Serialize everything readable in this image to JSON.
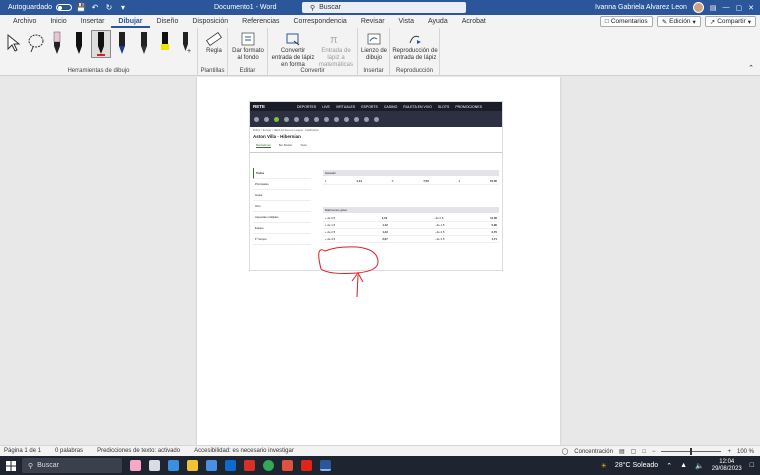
{
  "titlebar": {
    "autosave_label": "Autoguardado",
    "doc_title": "Documento1 - Word",
    "search_placeholder": "Buscar",
    "user_name": "Ivanna Gabriela Alvarez Leon"
  },
  "tabs": [
    "Archivo",
    "Inicio",
    "Insertar",
    "Dibujar",
    "Diseño",
    "Disposición",
    "Referencias",
    "Correspondencia",
    "Revisar",
    "Vista",
    "Ayuda",
    "Acrobat"
  ],
  "active_tab": "Dibujar",
  "tab_actions": {
    "comments": "Comentarios",
    "edit": "Edición",
    "share": "Compartir"
  },
  "ribbon": {
    "groups": {
      "drawing_tools": "Herramientas de dibujo",
      "stencils": "Plantillas",
      "edit": "Editar",
      "convert": "Convertir",
      "insert": "Insertar",
      "replay": "Reproducción"
    },
    "buttons": {
      "ruler": "Regla",
      "bg_format": "Dar formato al fondo",
      "ink_to_shape": "Convertir entrada de lápiz en forma",
      "ink_to_math": "Entrada de lápiz a matemáticas",
      "canvas": "Lienzo de dibujo",
      "ink_replay": "Reproducción de entrada de lápiz"
    }
  },
  "embedded": {
    "logo": "RETE",
    "nav": [
      "DEPORTES",
      "LIVE",
      "VIRTUALES",
      "ESPORTS",
      "CASINO",
      "RULETA EN VIVO",
      "SLOTS",
      "PROMOCIONES"
    ],
    "breadcrumb": "Fútbol > Europa > UEFA Conference League - Clasificación",
    "match_title": "Aston Villa - Hibernian",
    "match_tabs": [
      "Marcadores",
      "Bet Builder",
      "Stats"
    ],
    "sidebar": [
      "Todos",
      "Principales",
      "Goles",
      "Otro",
      "Apuestas múltiples",
      "Equipo",
      "1º tiempo"
    ],
    "markets": [
      {
        "title": "Ganador",
        "rows": [
          [
            "1",
            "1,14",
            "X",
            "7,50",
            "2",
            "15,00"
          ]
        ]
      },
      {
        "title": "Más/menos goles",
        "rows": [
          [
            "+ de 0,5",
            "1,01",
            "- de 0,5",
            "11,00"
          ],
          [
            "+ de 1,5",
            "1,12",
            "- de 1,5",
            "5,90"
          ],
          [
            "+ de 2,5",
            "1,43",
            "- de 2,5",
            "2,70"
          ],
          [
            "+ de 3,5",
            "2,07",
            "- de 3,5",
            "1,71"
          ]
        ]
      }
    ]
  },
  "statusbar": {
    "page": "Página 1 de 1",
    "words": "0 palabras",
    "predictions": "Predicciones de texto: activado",
    "accessibility": "Accesibilidad: es necesario investigar",
    "focus": "Concentración",
    "zoom": "100 %"
  },
  "taskbar": {
    "search": "Buscar",
    "weather": "28°C  Soleado",
    "time": "12:04",
    "date": "29/08/2023"
  }
}
